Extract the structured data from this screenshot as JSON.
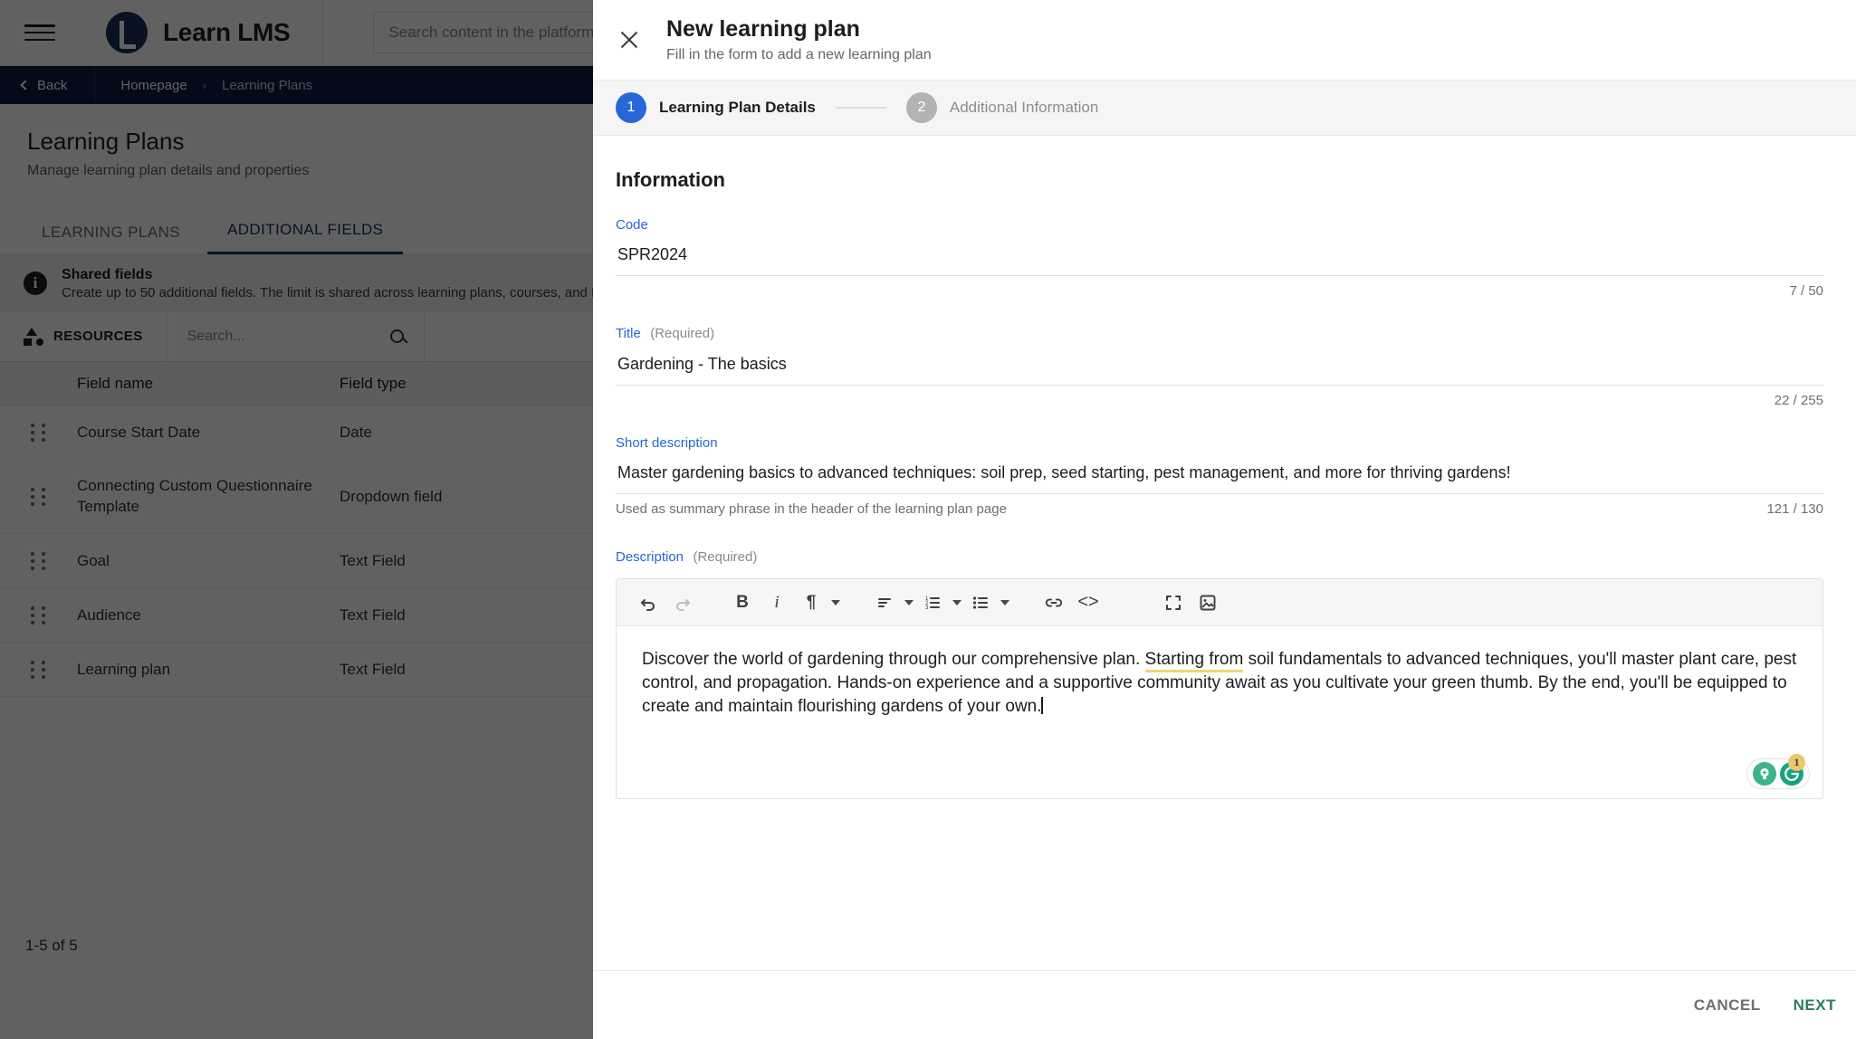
{
  "background": {
    "topbar": {
      "brand_name": "Learn LMS",
      "search_placeholder": "Search content in the platform",
      "menu_icon": "hamburger-icon",
      "logo_icon": "learn-lms-logo"
    },
    "breadcrumb": {
      "back_label": "Back",
      "items": [
        "Homepage",
        "Learning Plans"
      ],
      "separator": "›"
    },
    "page": {
      "title": "Learning Plans",
      "subtitle": "Manage learning plan details and properties"
    },
    "tabs": [
      {
        "label": "LEARNING PLANS",
        "active": false
      },
      {
        "label": "ADDITIONAL FIELDS",
        "active": true
      }
    ],
    "shared_banner": {
      "title": "Shared fields",
      "text": "Create up to 50 additional fields. The limit is shared across learning plans, courses, and ILT sessions",
      "icon": "info-icon"
    },
    "resources_bar": {
      "label": "RESOURCES",
      "search_placeholder": "Search...",
      "search_icon": "search-icon",
      "resources_icon": "shapes-icon"
    },
    "table": {
      "columns": [
        "Field name",
        "Field type"
      ],
      "rows": [
        {
          "name": "Course Start Date",
          "type": "Date"
        },
        {
          "name": "Connecting Custom Questionnaire Template",
          "type": "Dropdown field"
        },
        {
          "name": "Goal",
          "type": "Text Field"
        },
        {
          "name": "Audience",
          "type": "Text Field"
        },
        {
          "name": "Learning plan",
          "type": "Text Field"
        }
      ]
    },
    "pagination": "1-5 of 5"
  },
  "modal": {
    "title": "New learning plan",
    "subtitle": "Fill in the form to add a new learning plan",
    "close_icon": "close-icon",
    "steps": [
      {
        "num": "1",
        "label": "Learning Plan Details",
        "active": true
      },
      {
        "num": "2",
        "label": "Additional Information",
        "active": false
      }
    ],
    "section_title": "Information",
    "fields": {
      "code": {
        "label": "Code",
        "value": "SPR2024",
        "counter": "7 / 50"
      },
      "title": {
        "label": "Title",
        "required_text": "(Required)",
        "value": "Gardening - The basics",
        "counter": "22 / 255"
      },
      "short_description": {
        "label": "Short description",
        "value": "Master gardening basics to advanced techniques: soil prep, seed starting, pest management, and more for thriving gardens!",
        "hint": "Used as summary phrase in the header of the learning plan page",
        "counter": "121 / 130"
      },
      "description": {
        "label": "Description",
        "required_text": "(Required)",
        "text_before": "Discover the world of gardening through our comprehensive plan. ",
        "text_flagged": "Starting from",
        "text_after": " soil fundamentals to advanced techniques, you'll master plant care, pest control, and propagation. Hands-on experience and a supportive community await as you cultivate your green thumb. By the end, you'll be equipped to create and maintain flourishing gardens of your own."
      }
    },
    "toolbar": {
      "undo": "↰",
      "redo": "↱",
      "bold": "B",
      "italic": "i",
      "paragraph": "¶",
      "align": "align-left-icon",
      "ordered_list": "ordered-list-icon",
      "bullet_list": "bullet-list-icon",
      "link": "link-icon",
      "code": "<>",
      "fullscreen": "fullscreen-icon",
      "image": "image-icon"
    },
    "grammarly": {
      "count": "1",
      "assist_icon": "grammarly-bulb-icon",
      "logo_icon": "grammarly-g-icon"
    },
    "footer": {
      "cancel_label": "CANCEL",
      "next_label": "NEXT"
    }
  },
  "colors": {
    "accent_blue": "#2667d5",
    "brand_navy": "#16305c",
    "next_green": "#2c7d5e",
    "grammar_underline": "#f0d675"
  }
}
